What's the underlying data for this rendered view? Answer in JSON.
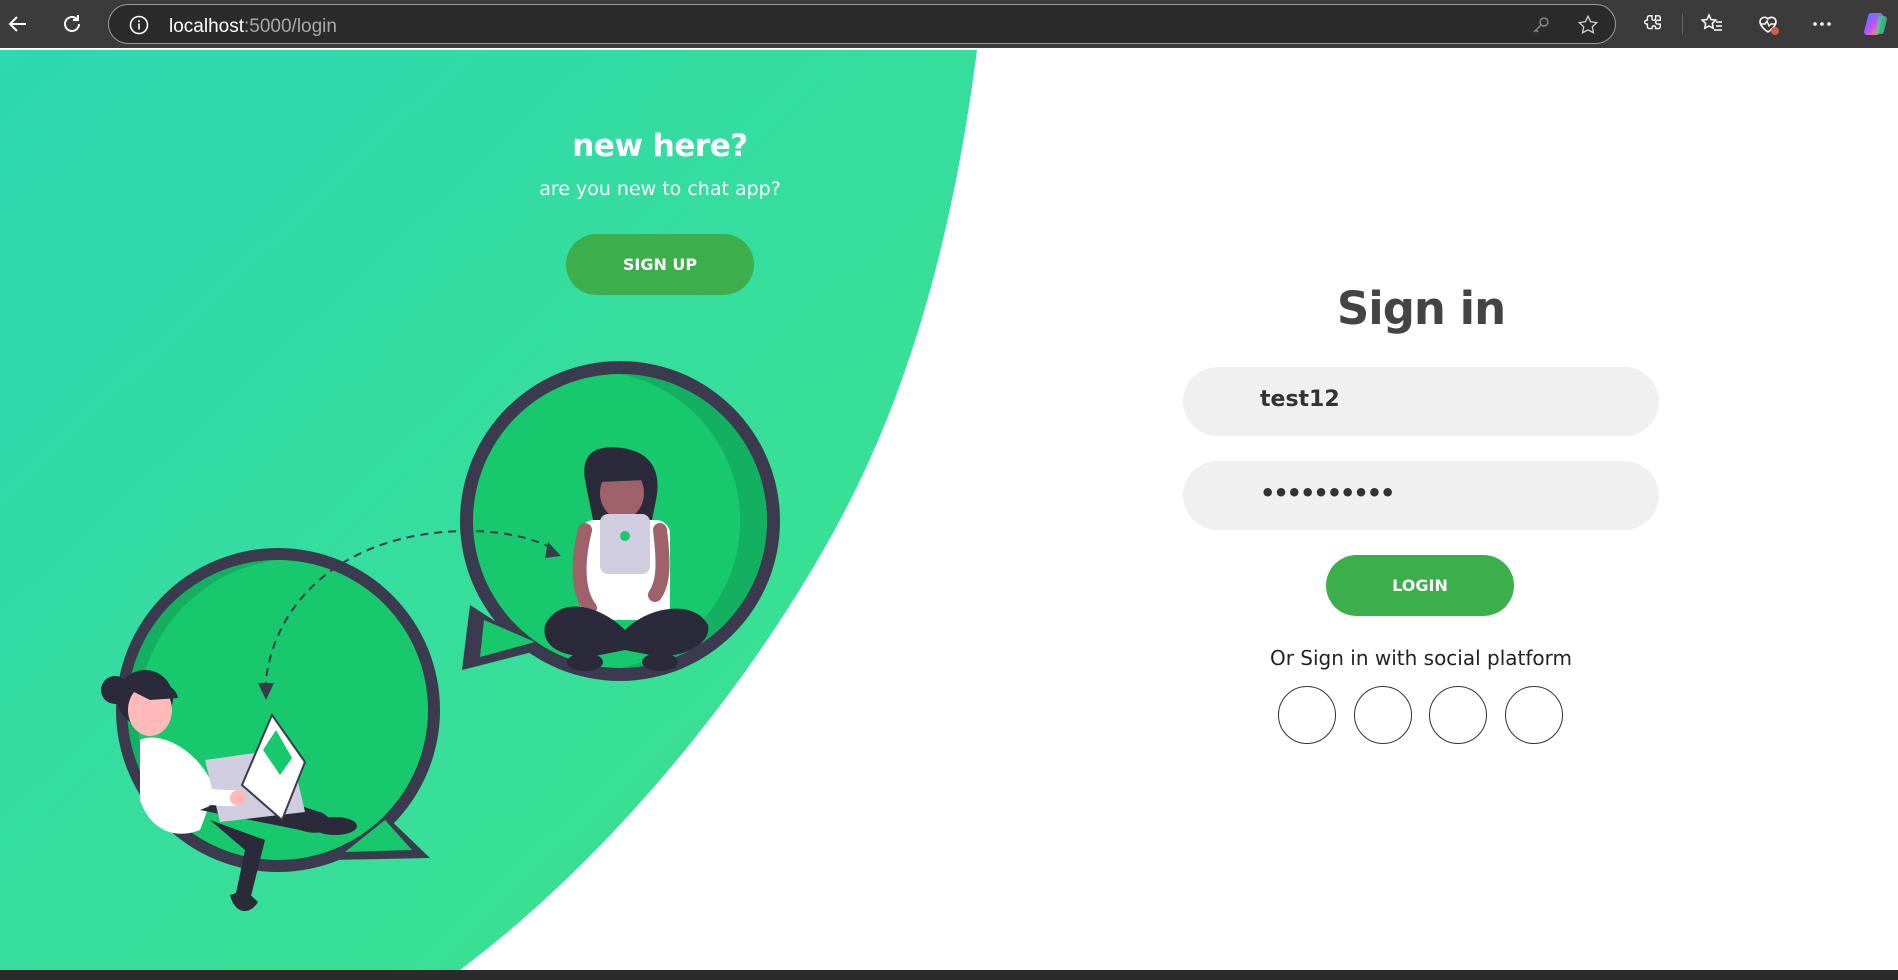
{
  "browser": {
    "url_host": "localhost",
    "url_path": ":5000/login"
  },
  "promo": {
    "title": "new here?",
    "subtitle": "are you new to chat app?",
    "signup_label": "SIGN UP"
  },
  "signin": {
    "title": "Sign in",
    "username_value": "test12",
    "password_value": "••••••••••",
    "login_label": "LOGIN",
    "social_text": "Or Sign in with social platform"
  },
  "colors": {
    "accent": "#3cae4c",
    "gradient_start": "#2ed8b0",
    "gradient_end": "#3de38a",
    "bubble": "#17c96c",
    "bubble_outline": "#3b3a4f"
  }
}
